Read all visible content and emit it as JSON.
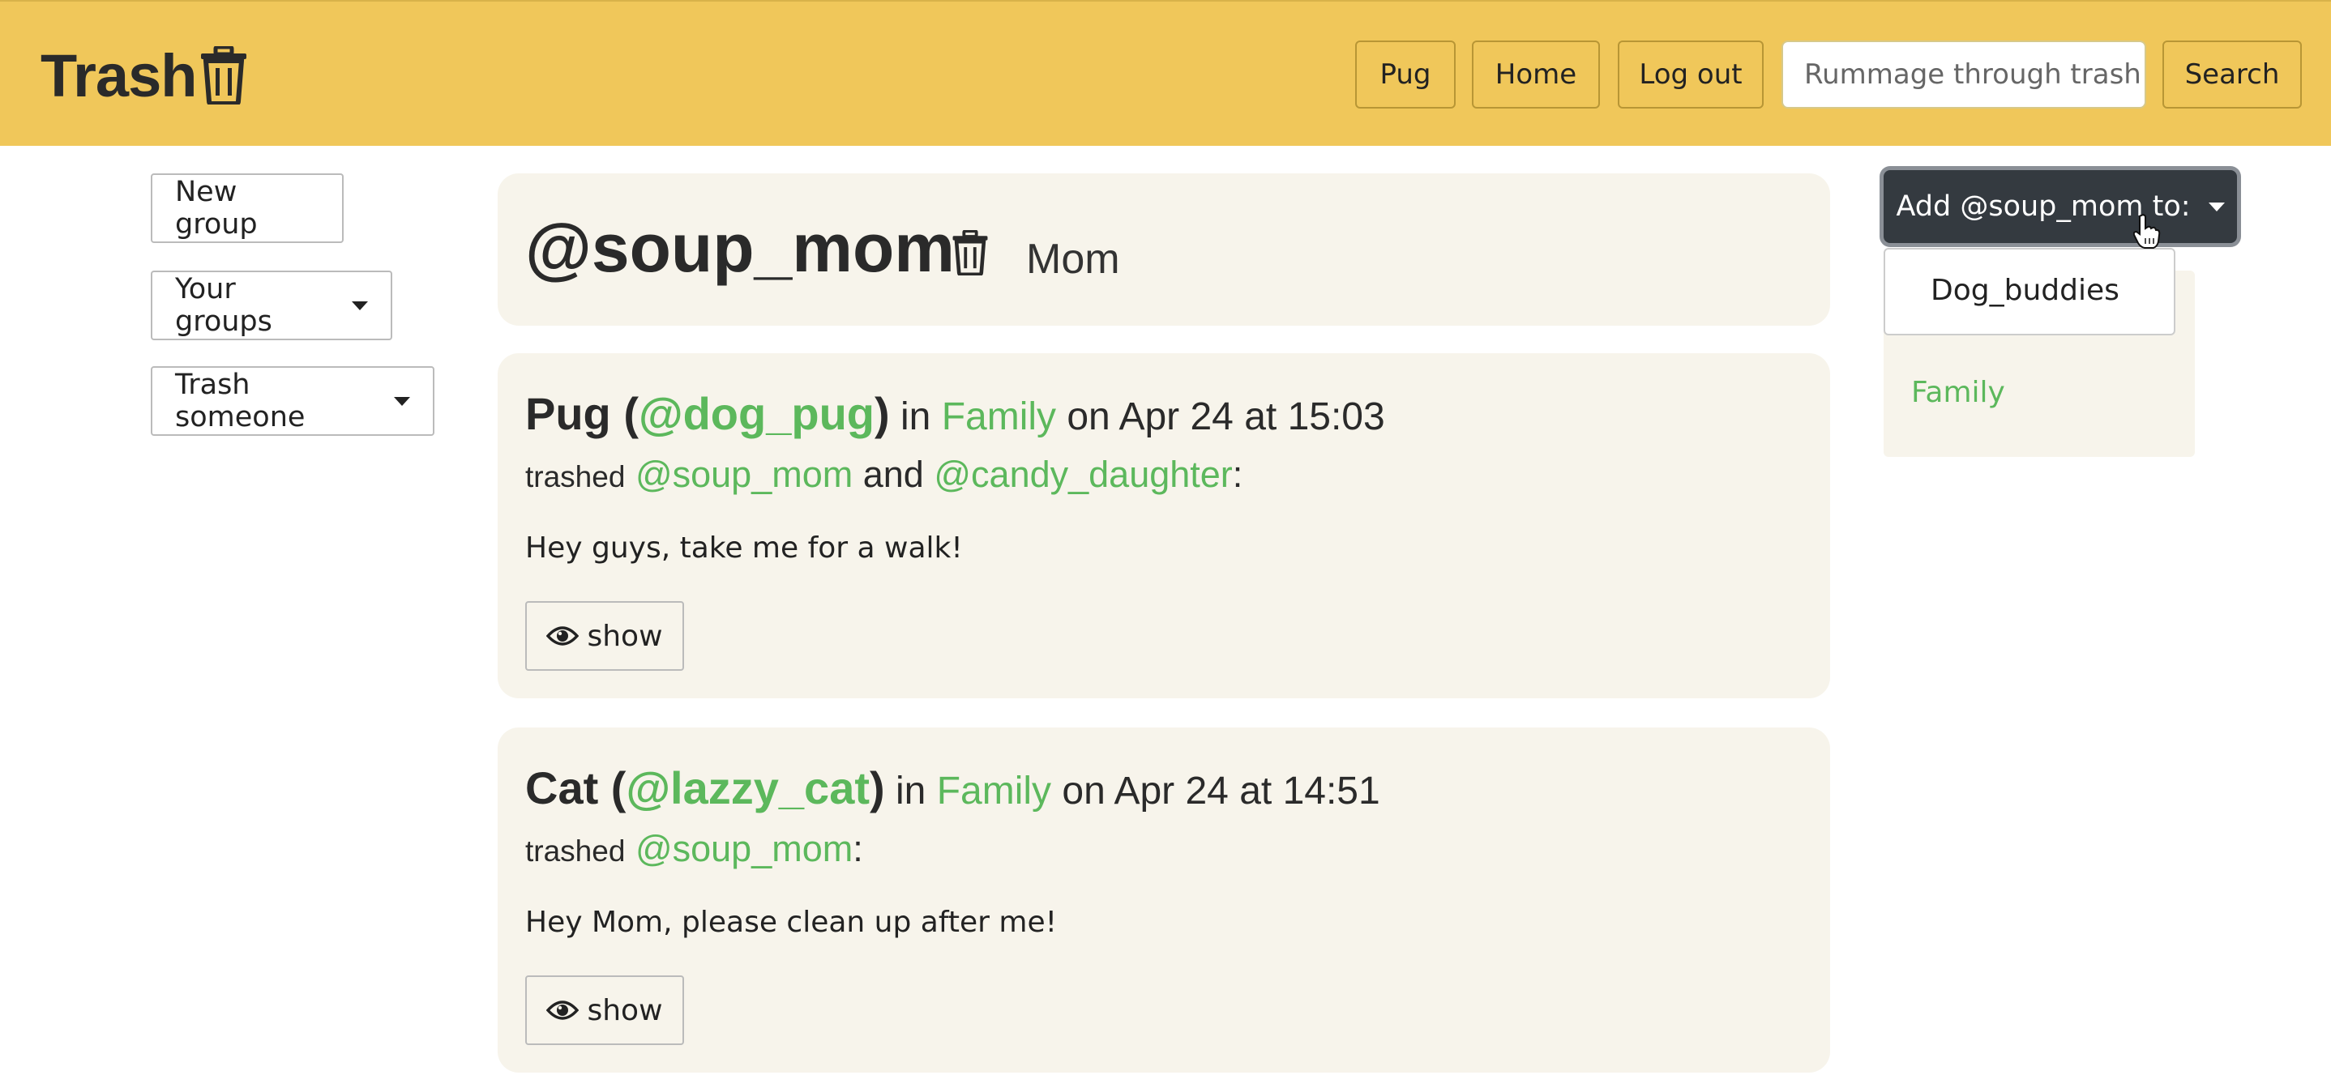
{
  "header": {
    "brand": "Trash",
    "nav": [
      "Pug",
      "Home",
      "Log out"
    ],
    "search": {
      "placeholder": "Rummage through trash",
      "button": "Search"
    }
  },
  "sidebar": {
    "new_group": "New group",
    "your_groups": "Your groups",
    "trash_someone": "Trash someone"
  },
  "profile": {
    "handle": "@soup_mom",
    "name": "Mom"
  },
  "posts": [
    {
      "author": "Pug",
      "handle": "@dog_pug",
      "in_label": "in",
      "group": "Family",
      "date_text": "on Apr 24 at 15:03",
      "trashed_label": "trashed",
      "targets": [
        "@soup_mom",
        "@candy_daughter"
      ],
      "joiner": "and",
      "body": "Hey guys, take me for a walk!",
      "show_label": "show"
    },
    {
      "author": "Cat",
      "handle": "@lazzy_cat",
      "in_label": "in",
      "group": "Family",
      "date_text": "on Apr 24 at 14:51",
      "trashed_label": "trashed",
      "targets": [
        "@soup_mom"
      ],
      "body": "Hey Mom, please clean up after me!",
      "show_label": "show"
    }
  ],
  "add_to": {
    "label": "Add @soup_mom to:",
    "options": [
      "Dog_buddies"
    ]
  },
  "groups_panel": {
    "link": "Family"
  },
  "colors": {
    "navbar": "#f0c75a",
    "link": "#5cb85c",
    "card": "#f7f4eb",
    "dark_button": "#343a40"
  }
}
